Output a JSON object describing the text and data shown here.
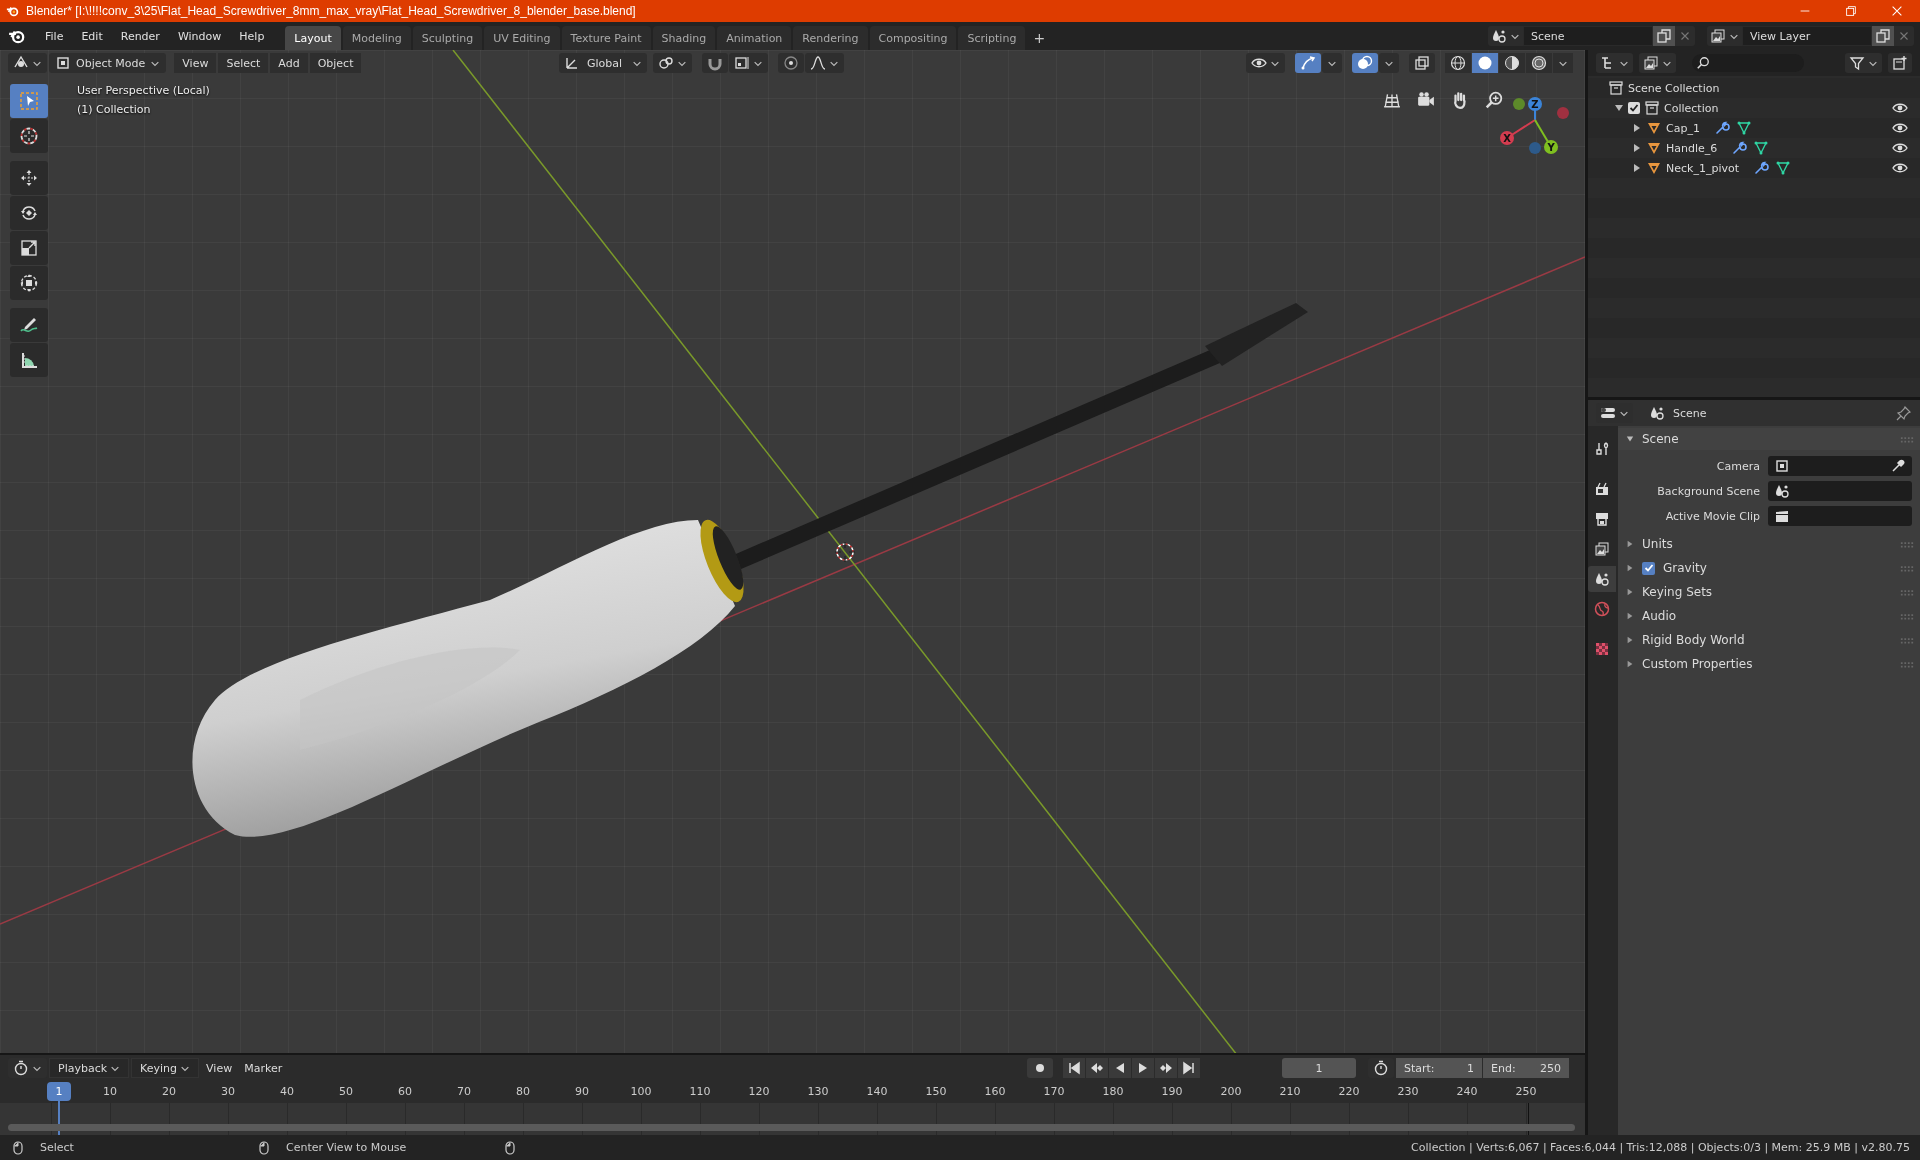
{
  "window": {
    "title": "Blender* [I:\\!!!!conv_3\\25\\Flat_Head_Screwdriver_8mm_max_vray\\Flat_Head_Screwdriver_8_blender_base.blend]"
  },
  "menu": [
    "File",
    "Edit",
    "Render",
    "Window",
    "Help"
  ],
  "workspaces": [
    {
      "label": "Layout",
      "selected": true
    },
    {
      "label": "Modeling",
      "selected": false
    },
    {
      "label": "Sculpting",
      "selected": false
    },
    {
      "label": "UV Editing",
      "selected": false
    },
    {
      "label": "Texture Paint",
      "selected": false
    },
    {
      "label": "Shading",
      "selected": false
    },
    {
      "label": "Animation",
      "selected": false
    },
    {
      "label": "Rendering",
      "selected": false
    },
    {
      "label": "Compositing",
      "selected": false
    },
    {
      "label": "Scripting",
      "selected": false
    }
  ],
  "add_workspace": "+",
  "scene_field": {
    "value": "Scene"
  },
  "view_layer_field": {
    "value": "View Layer"
  },
  "viewport": {
    "mode": "Object Mode",
    "menus": [
      "View",
      "Select",
      "Add",
      "Object"
    ],
    "orientation": "Global",
    "info": [
      "User Perspective (Local)",
      "(1) Collection"
    ],
    "tools": [
      {
        "kind": "select",
        "selected": true
      },
      {
        "kind": "cursor",
        "selected": false
      },
      {
        "kind": "move",
        "selected": false
      },
      {
        "kind": "rotate",
        "selected": false
      },
      {
        "kind": "scale",
        "selected": false
      },
      {
        "kind": "transform",
        "selected": false
      },
      {
        "kind": "annotate",
        "selected": false
      },
      {
        "kind": "measure",
        "selected": false
      }
    ],
    "gizmo_toggle": {
      "on": true
    },
    "overlay_toggle": {
      "on": true
    },
    "shading_modes": [
      {
        "kind": "wireframe",
        "selected": false
      },
      {
        "kind": "solid",
        "selected": true
      },
      {
        "kind": "material",
        "selected": false
      },
      {
        "kind": "rendered",
        "selected": false
      }
    ],
    "gizmo": {
      "x": "X",
      "y": "Y",
      "z": "Z"
    }
  },
  "outliner": {
    "root": "Scene Collection",
    "children": [
      {
        "label": "Collection",
        "checked": true,
        "expanded": true,
        "children": [
          {
            "label": "Cap_1",
            "expanded": false
          },
          {
            "label": "Handle_6",
            "expanded": false
          },
          {
            "label": "Neck_1_pivot",
            "expanded": false
          }
        ]
      }
    ]
  },
  "properties": {
    "context": "Scene",
    "tabs": [
      {
        "kind": "tool",
        "selected": false
      },
      {
        "kind": "render",
        "selected": false
      },
      {
        "kind": "output",
        "selected": false
      },
      {
        "kind": "viewlayer",
        "selected": false
      },
      {
        "kind": "scene",
        "selected": true
      },
      {
        "kind": "world",
        "selected": false
      },
      {
        "kind": "texture",
        "selected": false
      }
    ],
    "panel": {
      "title": "Scene",
      "expanded": true,
      "fields": [
        {
          "label": "Camera",
          "kind": "camera"
        },
        {
          "label": "Background Scene",
          "kind": "scene"
        },
        {
          "label": "Active Movie Clip",
          "kind": "clip"
        }
      ]
    },
    "subpanels": [
      {
        "label": "Units",
        "kind": "plain",
        "expanded": false
      },
      {
        "label": "Gravity",
        "kind": "checkbox",
        "checked": true,
        "expanded": false
      },
      {
        "label": "Keying Sets",
        "kind": "plain",
        "expanded": false
      },
      {
        "label": "Audio",
        "kind": "plain",
        "expanded": false
      },
      {
        "label": "Rigid Body World",
        "kind": "plain",
        "expanded": false
      },
      {
        "label": "Custom Properties",
        "kind": "plain",
        "expanded": false
      }
    ]
  },
  "timeline": {
    "menus": [
      "Playback",
      "Keying",
      "View",
      "Marker"
    ],
    "current_frame": "1",
    "playhead_label": "1",
    "start": {
      "label": "Start:",
      "value": "1"
    },
    "end": {
      "label": "End:",
      "value": "250"
    },
    "ruler": [
      "10",
      "20",
      "30",
      "40",
      "50",
      "60",
      "70",
      "80",
      "90",
      "100",
      "110",
      "120",
      "130",
      "140",
      "150",
      "160",
      "170",
      "180",
      "190",
      "200",
      "210",
      "220",
      "230",
      "240",
      "250"
    ]
  },
  "status_bar": {
    "hints": [
      "Select",
      "Center View to Mouse"
    ],
    "stats": "Collection | Verts:6,067 | Faces:6,044 | Tris:12,088 | Objects:0/3 | Mem: 25.9 MB | v2.80.75"
  }
}
